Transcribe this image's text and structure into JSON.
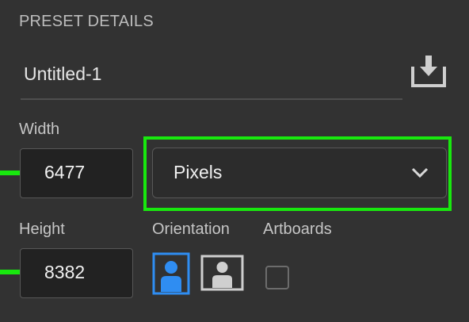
{
  "section": {
    "title": "PRESET DETAILS"
  },
  "preset": {
    "name": "Untitled-1",
    "save_icon": "save-preset-icon"
  },
  "width": {
    "label": "Width",
    "value": "6477"
  },
  "units": {
    "selected": "Pixels",
    "icon": "chevron-down-icon"
  },
  "height": {
    "label": "Height",
    "value": "8382"
  },
  "orientation": {
    "label": "Orientation",
    "selected": "portrait"
  },
  "artboards": {
    "label": "Artboards",
    "checked": false
  },
  "colors": {
    "accent_blue": "#2f8df2",
    "annotation_green": "#18e80e"
  }
}
